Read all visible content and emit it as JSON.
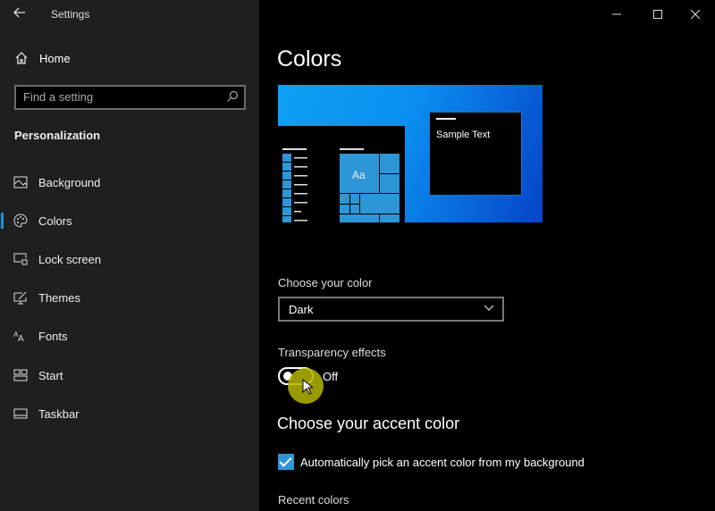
{
  "window": {
    "title": "Settings",
    "controls": [
      "minimize",
      "maximize",
      "close"
    ]
  },
  "sidebar": {
    "home_label": "Home",
    "search": {
      "placeholder": "Find a setting"
    },
    "section": "Personalization",
    "items": [
      {
        "label": "Background",
        "icon": "picture-icon"
      },
      {
        "label": "Colors",
        "icon": "palette-icon",
        "selected": true
      },
      {
        "label": "Lock screen",
        "icon": "lock-screen-icon"
      },
      {
        "label": "Themes",
        "icon": "themes-icon"
      },
      {
        "label": "Fonts",
        "icon": "fonts-icon"
      },
      {
        "label": "Start",
        "icon": "start-icon"
      },
      {
        "label": "Taskbar",
        "icon": "taskbar-icon"
      }
    ]
  },
  "main": {
    "title": "Colors",
    "preview": {
      "sample_text": "Sample Text",
      "tile_text": "Aa"
    },
    "choose_color": {
      "label": "Choose your color",
      "value": "Dark"
    },
    "transparency": {
      "label": "Transparency effects",
      "state": "Off",
      "on": false
    },
    "accent": {
      "heading": "Choose your accent color",
      "auto_pick_label": "Automatically pick an accent color from my background",
      "auto_pick_checked": true
    },
    "recent_colors_label": "Recent colors"
  },
  "colors": {
    "accent": "#2d96d6",
    "sidebar_bg": "#1f1f1f",
    "main_bg": "#000000"
  }
}
